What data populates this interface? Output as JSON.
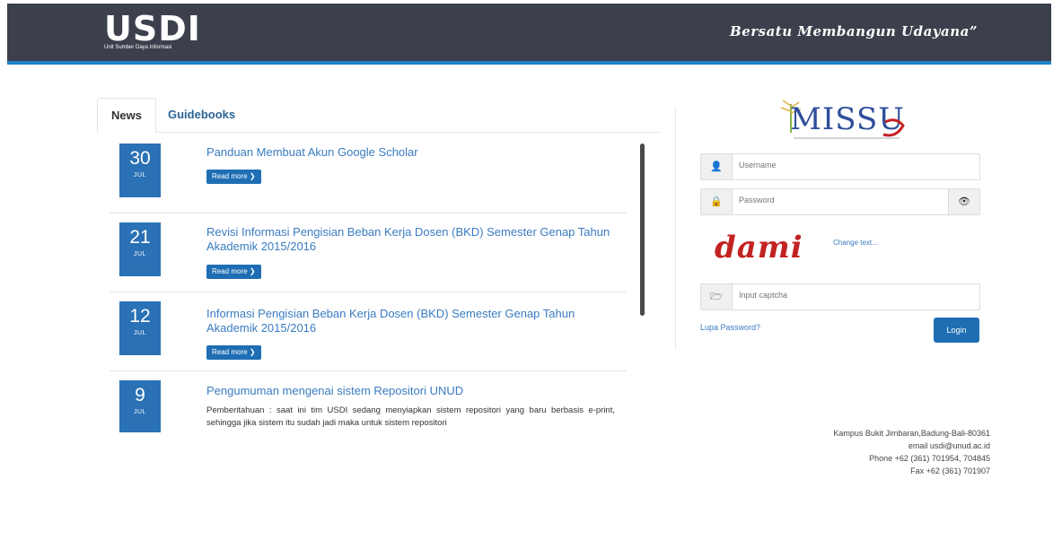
{
  "header": {
    "logo_title": "USDI",
    "logo_subtitle": "Unit Sumber Daya Informasi",
    "tagline": "Bersatu Membangun Udayana”"
  },
  "tabs": [
    {
      "label": "News",
      "active": true
    },
    {
      "label": "Guidebooks",
      "active": false
    }
  ],
  "news": [
    {
      "day": "30",
      "month": "JUL",
      "title": "Panduan Membuat Akun Google Scholar",
      "read_more": "Read more"
    },
    {
      "day": "21",
      "month": "JUL",
      "title": "Revisi Informasi Pengisian Beban Kerja Dosen (BKD) Semester Genap Tahun Akademik 2015/2016",
      "read_more": "Read more"
    },
    {
      "day": "12",
      "month": "JUL",
      "title": "Informasi Pengisian Beban Kerja Dosen (BKD) Semester Genap Tahun Akademik 2015/2016",
      "read_more": "Read more"
    },
    {
      "day": "9",
      "month": "JUL",
      "title": "Pengumuman mengenai sistem Repositori UNUD",
      "excerpt": "Pemberitahuan : saat ini tim USDI sedang menyiapkan sistem repositori yang baru berbasis e-print, sehingga jika sistem itu sudah jadi maka untuk sistem repositori"
    }
  ],
  "login": {
    "logo_text": "MISSU",
    "username_placeholder": "Username",
    "password_placeholder": "Password",
    "captcha_text": "dami",
    "change_text": "Change text...",
    "captcha_placeholder": "Input captcha",
    "forgot_password": "Lupa Password?",
    "login_button": "Login"
  },
  "address": {
    "line1": "Kampus Bukit Jimbaran,Badung-Bali-80361",
    "line2": "email usdi@unud.ac.id",
    "line3": "Phone +62 (361) 701954, 704845",
    "line4": "Fax +62 (361) 701907"
  },
  "colors": {
    "header_bg": "#3b404c",
    "accent_blue": "#1f83c6",
    "date_box": "#2a71b5",
    "link": "#3a7cc1",
    "captcha_red": "#c32222"
  }
}
